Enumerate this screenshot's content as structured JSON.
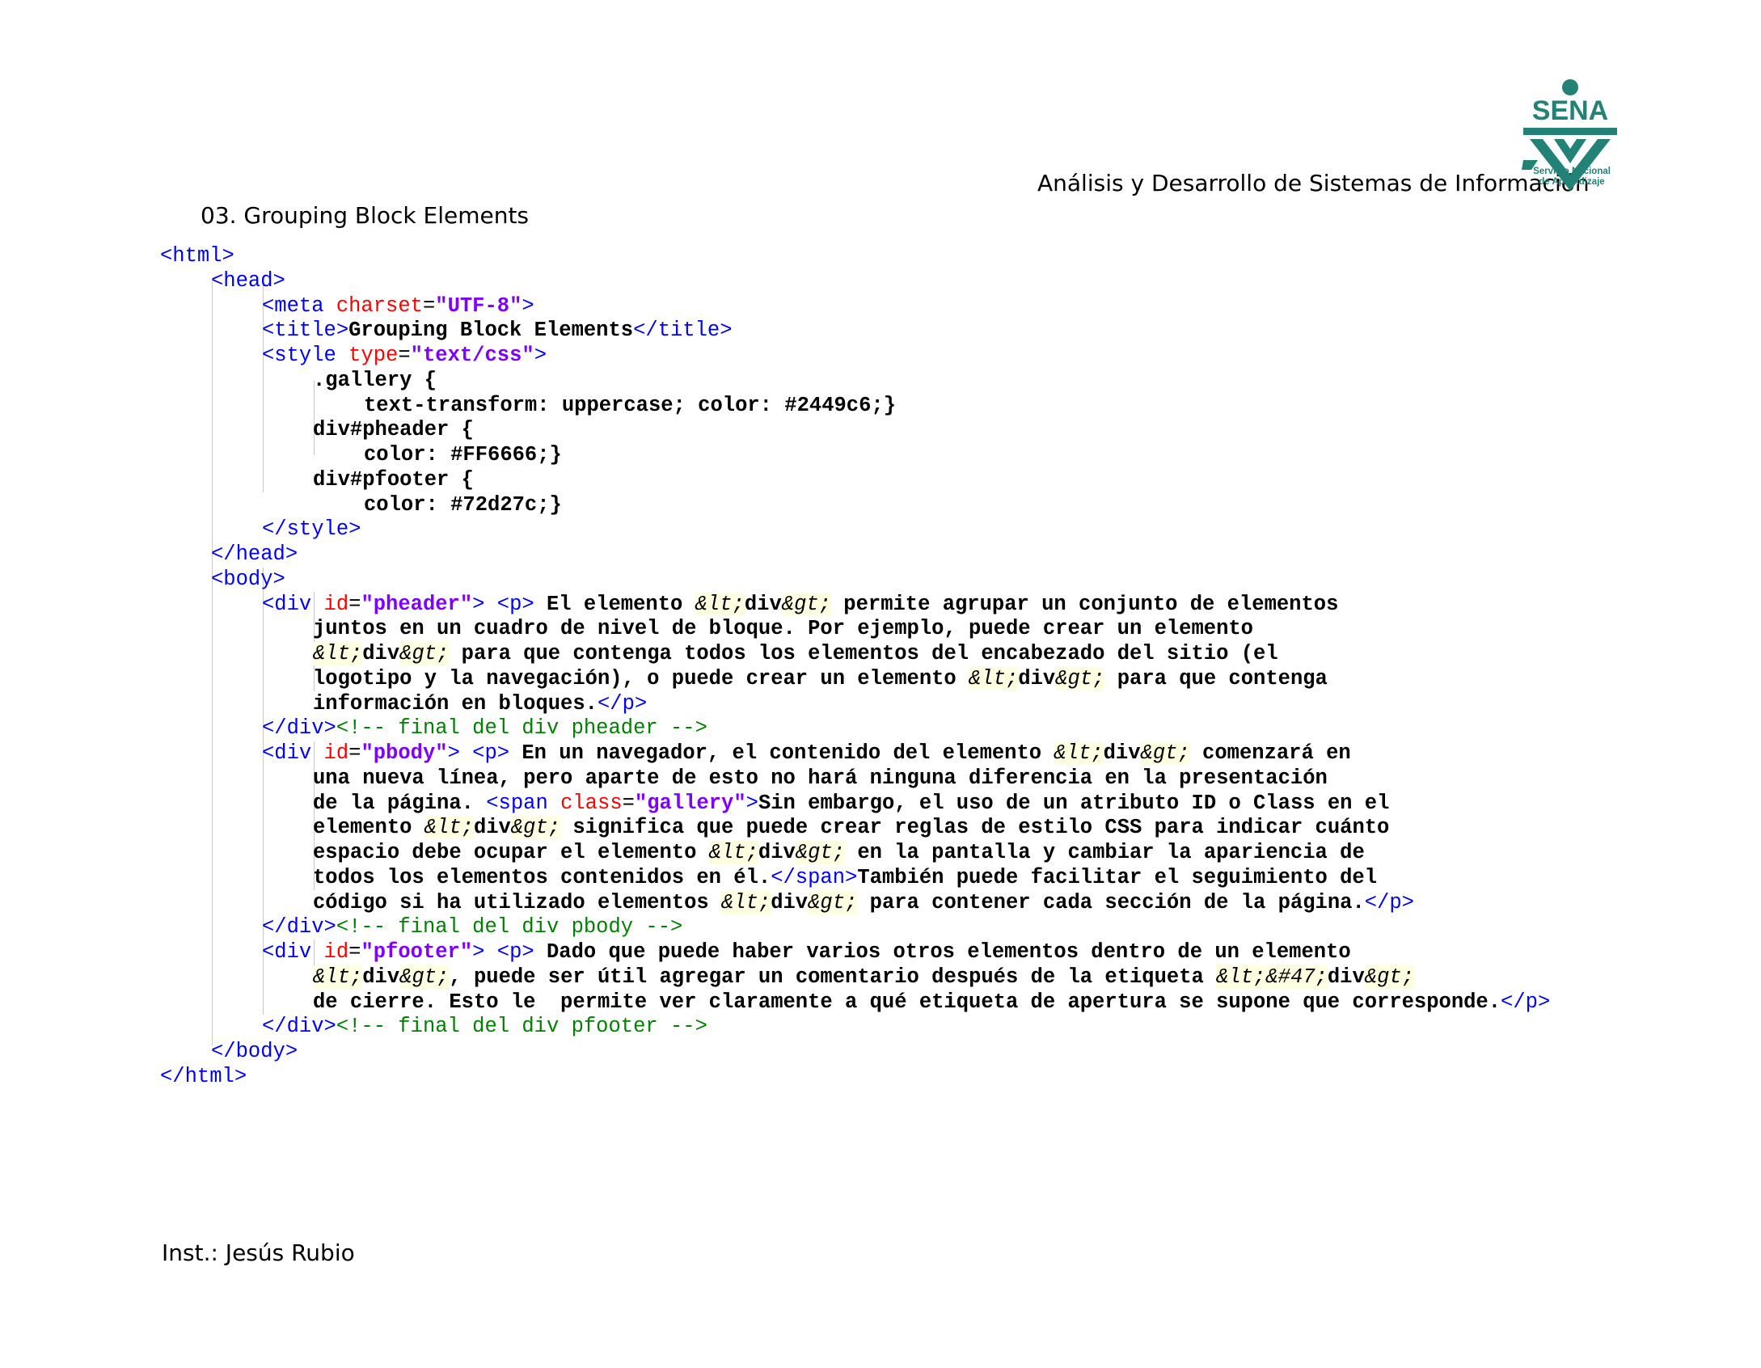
{
  "header": {
    "program": "Análisis y Desarrollo de Sistemas de Información",
    "logo": {
      "name": "SENA",
      "line1": "Servicio Nacional",
      "line2": "de Aprendizaje",
      "color": "#238276"
    }
  },
  "section_title": "03.  Grouping Block Elements",
  "footer": "Inst.: Jesús Rubio",
  "colors": {
    "tag": "#0000ff",
    "attribute": "#ff0000",
    "value": "#8000ff",
    "comment": "#008000"
  },
  "code": {
    "l1_tag": "<html>",
    "l2_tag": "<head>",
    "l3_open": "<meta ",
    "l3_attr": "charset",
    "l3_eq": "=",
    "l3_val": "\"UTF-8\"",
    "l3_close": ">",
    "l4_open": "<title>",
    "l4_text": "Grouping Block Elements",
    "l4_close": "</title>",
    "l5_open": "<style ",
    "l5_attr": "type",
    "l5_eq": "=",
    "l5_val": "\"text/css\"",
    "l5_close": ">",
    "l6": ".gallery {",
    "l7": "text-transform: uppercase; color: #2449c6;}",
    "l8": "div#pheader {",
    "l9": "color: #FF6666;}",
    "l10": "div#pfooter {",
    "l11": "color: #72d27c;}",
    "l12_tag": "</style>",
    "l13_tag": "</head>",
    "l14_tag": "<body>",
    "l15_open": "<div ",
    "l15_attr": "id",
    "l15_eq": "=",
    "l15_val": "\"pheader\"",
    "l15_close": "> <p>",
    "l15_t1": " El elemento ",
    "ent_lt": "&lt;",
    "ent_gt": "&gt;",
    "ent_slash": "&#47;",
    "div_word": "div",
    "l15_t2": " permite agrupar un conjunto de elementos",
    "l16": "juntos en un cuadro de nivel de bloque. Por ejemplo, puede crear un elemento",
    "l17_t": " para que contenga todos los elementos del encabezado del sitio (el",
    "l18_t1": "logotipo y la navegación), o puede crear un elemento ",
    "l18_t2": " para que contenga",
    "l19_t": "información en bloques.",
    "p_close": "</p>",
    "div_close": "</div>",
    "l20_comment": "<!-- final del div pheader -->",
    "l21_open": "<div ",
    "l21_attr": "id",
    "l21_eq": "=",
    "l21_val": "\"pbody\"",
    "l21_close": "> <p>",
    "l21_t1": " En un navegador, el contenido del elemento ",
    "l21_t2": " comenzará en",
    "l22": "una nueva línea, pero aparte de esto no hará ninguna diferencia en la presentación",
    "l23_t1": "de la página. ",
    "l23_span_open": "<span ",
    "l23_attr": "class",
    "l23_eq": "=",
    "l23_val": "\"gallery\"",
    "l23_gt": ">",
    "l23_t2": "Sin embargo, el uso de un atributo ID o Class en el",
    "l24_t1": "elemento ",
    "l24_t2": " significa que puede crear reglas de estilo CSS para indicar cuánto",
    "l25_t1": "espacio debe ocupar el elemento ",
    "l25_t2": " en la pantalla y cambiar la apariencia de",
    "l26_t1": "todos los elementos contenidos en él.",
    "l26_span_close": "</span>",
    "l26_t2": "También puede facilitar el seguimiento del",
    "l27_t1": "código si ha utilizado elementos ",
    "l27_t2": " para contener cada sección de la página.",
    "l28_comment": "<!-- final del div pbody -->",
    "l29_open": "<div ",
    "l29_attr": "id",
    "l29_eq": "=",
    "l29_val": "\"pfooter\"",
    "l29_close": "> <p>",
    "l29_t": " Dado que puede haber varios otros elementos dentro de un elemento",
    "l30_t1": ", puede ser útil agregar un comentario después de la etiqueta ",
    "l31_t": "de cierre. Esto le  permite ver claramente a qué etiqueta de apertura se supone que corresponde.",
    "l32_comment": "<!-- final del div pfooter -->",
    "l33_tag": "</body>",
    "l34_tag": "</html>"
  }
}
